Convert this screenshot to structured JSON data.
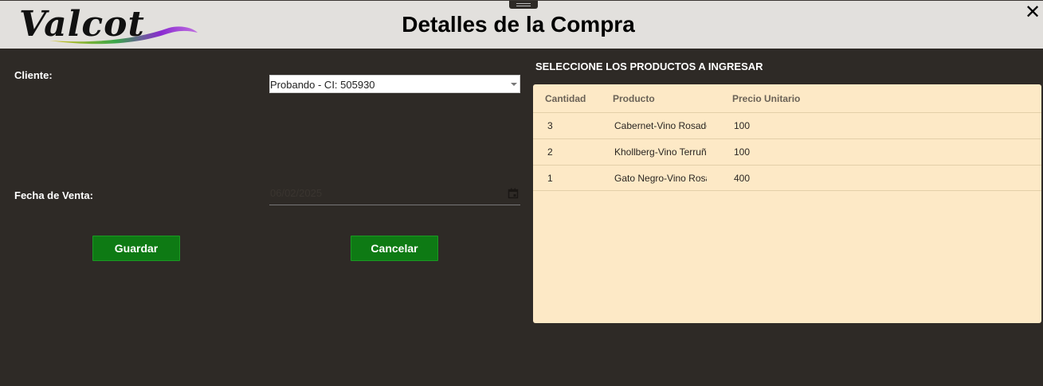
{
  "header": {
    "logo_text": "Valcot",
    "title": "Detalles de la Compra",
    "close_label": "✕"
  },
  "form": {
    "client_label": "Cliente:",
    "client_value": "Probando - CI: 505930",
    "date_label": "Fecha de Venta:",
    "date_value": "06/02/2025",
    "save_label": "Guardar",
    "cancel_label": "Cancelar"
  },
  "products": {
    "section_title": "SELECCIONE LOS PRODUCTOS A INGRESAR",
    "columns": [
      "Cantidad",
      "Producto",
      "Precio Unitario"
    ],
    "rows": [
      {
        "cantidad": "3",
        "producto": "Cabernet-Vino Rosado",
        "precio": "100"
      },
      {
        "cantidad": "2",
        "producto": "Khollberg-Vino Terruño",
        "precio": "100"
      },
      {
        "cantidad": "1",
        "producto": "Gato Negro-Vino Rosado",
        "precio": "400"
      }
    ]
  },
  "colors": {
    "background": "#2e2a26",
    "header": "#e2e0dd",
    "button": "#0e7a14",
    "table_bg": "#fde9c6"
  },
  "icons": [
    "logo-swoosh",
    "close-icon",
    "calendar-icon",
    "dropdown-caret-icon",
    "drag-handle-icon"
  ]
}
